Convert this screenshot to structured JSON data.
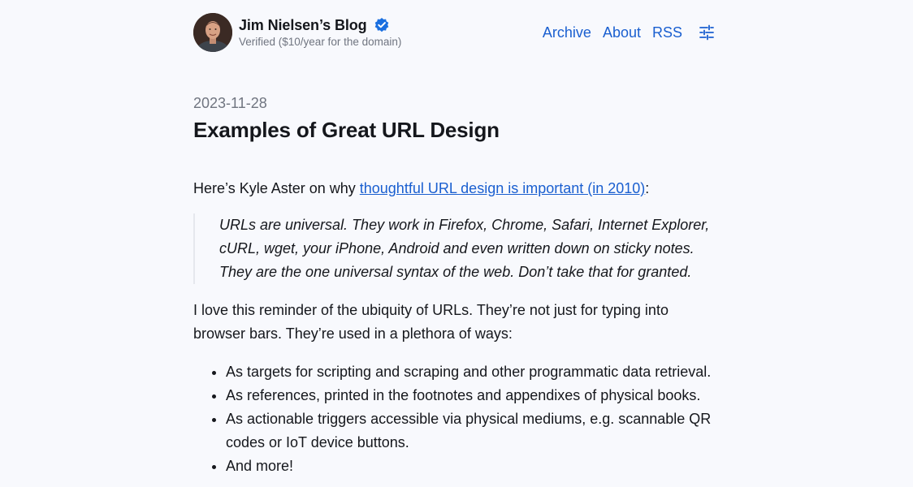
{
  "header": {
    "site_title": "Jim Nielsen’s Blog",
    "site_subtitle": "Verified ($10/year for the domain)",
    "nav": [
      {
        "label": "Archive"
      },
      {
        "label": "About"
      },
      {
        "label": "RSS"
      }
    ],
    "icons": {
      "avatar": "author-avatar",
      "verified": "verified-badge-icon",
      "settings": "sliders-settings-icon"
    },
    "colors": {
      "link": "#1a5fd0",
      "verified_badge": "#1a6fe0",
      "background": "#f8f9fd"
    }
  },
  "post": {
    "date": "2023-11-28",
    "title": "Examples of Great URL Design",
    "intro_prefix": "Here’s Kyle Aster on why ",
    "intro_link": "thoughtful URL design is important (in 2010)",
    "intro_suffix": ":",
    "blockquote_lines": [
      "URLs are universal. They work in Firefox, Chrome, Safari, Internet Explorer,",
      "cURL, wget, your iPhone, Android and even written down on sticky notes.",
      "They are the one universal syntax of the web. Don’t take that for granted."
    ],
    "paragraph2_lines": [
      "I love this reminder of the ubiquity of URLs. They’re not just for typing into",
      "browser bars. They’re used in a plethora of ways:"
    ],
    "list_items": [
      {
        "lines": [
          "As targets for scripting and scraping and other programmatic data retrieval."
        ]
      },
      {
        "lines": [
          "As references, printed in the footnotes and appendixes of physical books."
        ]
      },
      {
        "lines": [
          "As actionable triggers accessible via physical mediums, e.g. scannable QR",
          "codes or IoT device buttons."
        ]
      },
      {
        "lines": [
          "And more!"
        ]
      }
    ]
  }
}
